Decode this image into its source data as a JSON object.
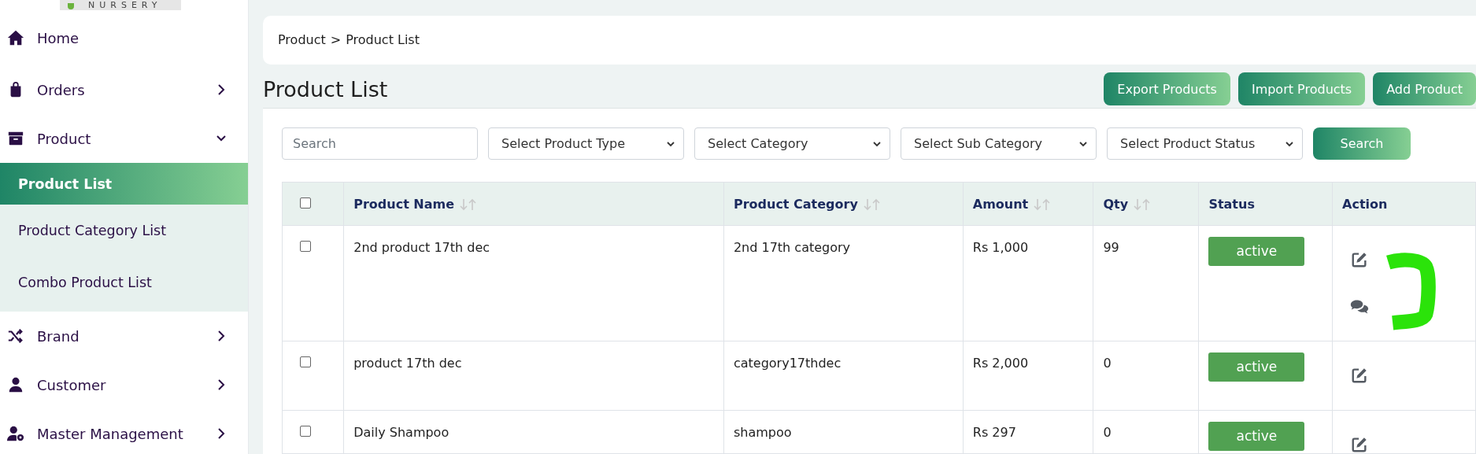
{
  "logo": {
    "text": "NURSERY"
  },
  "sidebar": {
    "items": [
      {
        "label": "Home",
        "kind": "link"
      },
      {
        "label": "Orders",
        "kind": "menu",
        "expanded": false
      },
      {
        "label": "Product",
        "kind": "menu",
        "expanded": true,
        "children": [
          {
            "label": "Product List",
            "selected": true
          },
          {
            "label": "Product Category List",
            "selected": false
          },
          {
            "label": "Combo Product List",
            "selected": false
          }
        ]
      },
      {
        "label": "Brand",
        "kind": "menu",
        "expanded": false
      },
      {
        "label": "Customer",
        "kind": "menu",
        "expanded": false
      },
      {
        "label": "Master Management",
        "kind": "menu",
        "expanded": false
      }
    ]
  },
  "breadcrumb": {
    "parts": [
      "Product",
      "Product List"
    ],
    "separator": ">"
  },
  "page_title": "Product List",
  "header_buttons": [
    "Export Products",
    "Import Products",
    "Add Product"
  ],
  "filters": {
    "search": {
      "placeholder": "Search"
    },
    "selects": [
      "Select Product Type",
      "Select Category",
      "Select Sub Category",
      "Select Product Status"
    ],
    "button": "Search"
  },
  "table": {
    "select_all": {
      "checked": false
    },
    "columns": [
      {
        "label": "Product Name",
        "sortable": true
      },
      {
        "label": "Product Category",
        "sortable": true
      },
      {
        "label": "Amount",
        "sortable": true
      },
      {
        "label": "Qty",
        "sortable": true
      },
      {
        "label": "Status",
        "sortable": false
      },
      {
        "label": "Action",
        "sortable": false
      }
    ],
    "rows": [
      {
        "checked": false,
        "name": "2nd product 17th dec",
        "category": "2nd 17th category",
        "amount": "Rs 1,000",
        "qty": "99",
        "status": "active",
        "actions": [
          {
            "kind": "edit"
          },
          {
            "kind": "chat"
          }
        ]
      },
      {
        "checked": false,
        "name": "product 17th dec",
        "category": "category17thdec",
        "amount": "Rs 2,000",
        "qty": "0",
        "status": "active",
        "actions": [
          {
            "kind": "edit"
          }
        ]
      },
      {
        "checked": false,
        "name": "Daily Shampoo",
        "category": "shampoo",
        "amount": "Rs 297",
        "qty": "0",
        "status": "active",
        "actions": [
          {
            "kind": "edit"
          }
        ]
      }
    ]
  }
}
